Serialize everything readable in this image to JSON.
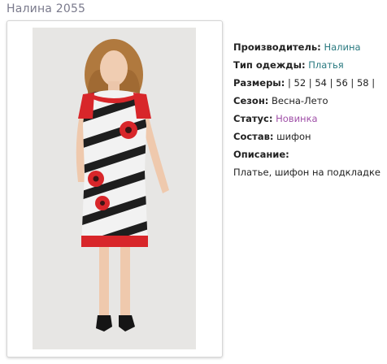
{
  "title": "Налина 2055",
  "photo": {
    "icon": "dress-model-photo"
  },
  "product": {
    "manufacturer": {
      "label": "Производитель:",
      "value": "Налина"
    },
    "clothing_type": {
      "label": "Тип одежды:",
      "value": "Платья"
    },
    "sizes": {
      "label": "Размеры:",
      "value": "| 52 | 54 | 56 | 58 |"
    },
    "season": {
      "label": "Сезон:",
      "value": "Весна-Лето"
    },
    "status": {
      "label": "Статус:",
      "value": "Новинка"
    },
    "composition": {
      "label": "Состав:",
      "value": "шифон"
    },
    "description": {
      "label": "Описание:",
      "value": "Платье, шифон на подкладке"
    }
  },
  "colors": {
    "title": "#7a7a8c",
    "link": "#2a7a80",
    "status": "#a050a8"
  }
}
